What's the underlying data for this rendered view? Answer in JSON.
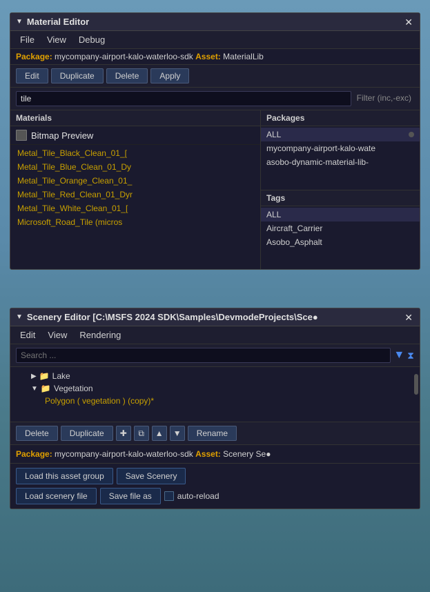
{
  "material_editor": {
    "title": "Material Editor",
    "menu": {
      "file": "File",
      "view": "View",
      "debug": "Debug"
    },
    "package_bar": {
      "pkg_label": "Package:",
      "pkg_value": "mycompany-airport-kalo-waterloo-sdk",
      "asset_label": "Asset:",
      "asset_value": "MaterialLib"
    },
    "toolbar": {
      "edit": "Edit",
      "duplicate": "Duplicate",
      "delete": "Delete",
      "apply": "Apply"
    },
    "filter": {
      "value": "tile",
      "placeholder": "tile",
      "label": "Filter (inc,-exc)"
    },
    "materials_col": {
      "header": "Materials",
      "bitmap_preview": "Bitmap Preview",
      "items": [
        "Metal_Tile_Black_Clean_01_[",
        "Metal_Tile_Blue_Clean_01_Dy",
        "Metal_Tile_Orange_Clean_01_",
        "Metal_Tile_Red_Clean_01_Dyr",
        "Metal_Tile_White_Clean_01_[",
        "Microsoft_Road_Tile (micros"
      ]
    },
    "packages_col": {
      "header": "Packages",
      "items": [
        {
          "label": "ALL",
          "selected": true
        },
        {
          "label": "mycompany-airport-kalo-wate",
          "selected": false
        },
        {
          "label": "asobo-dynamic-material-lib-",
          "selected": false
        }
      ],
      "tags_label": "Tags",
      "tags": [
        {
          "label": "ALL",
          "selected": true
        },
        {
          "label": "Aircraft_Carrier",
          "selected": false
        },
        {
          "label": "Asobo_Asphalt",
          "selected": false
        }
      ]
    }
  },
  "scenery_editor": {
    "title": "Scenery Editor [C:\\MSFS 2024 SDK\\Samples\\DevmodeProjects\\Sce●",
    "menu": {
      "edit": "Edit",
      "view": "View",
      "rendering": "Rendering"
    },
    "search_placeholder": "Search ...",
    "tree": [
      {
        "indent": 1,
        "expanded": false,
        "type": "folder",
        "label": "Lake"
      },
      {
        "indent": 1,
        "expanded": true,
        "type": "folder",
        "label": "Vegetation"
      },
      {
        "indent": 2,
        "expanded": false,
        "type": "item",
        "label": "Polygon ( vegetation ) (copy)*"
      }
    ],
    "toolbar": {
      "delete": "Delete",
      "duplicate": "Duplicate",
      "rename": "Rename"
    },
    "package_bar": {
      "pkg_label": "Package:",
      "pkg_value": "mycompany-airport-kalo-waterloo-sdk",
      "asset_label": "Asset:",
      "asset_value": "Scenery",
      "extra": "Se●"
    },
    "actions": {
      "load_asset_group": "Load this asset group",
      "save_scenery": "Save Scenery",
      "load_scenery_file": "Load scenery file",
      "save_file_as": "Save file as",
      "auto_reload": "auto-reload"
    }
  }
}
